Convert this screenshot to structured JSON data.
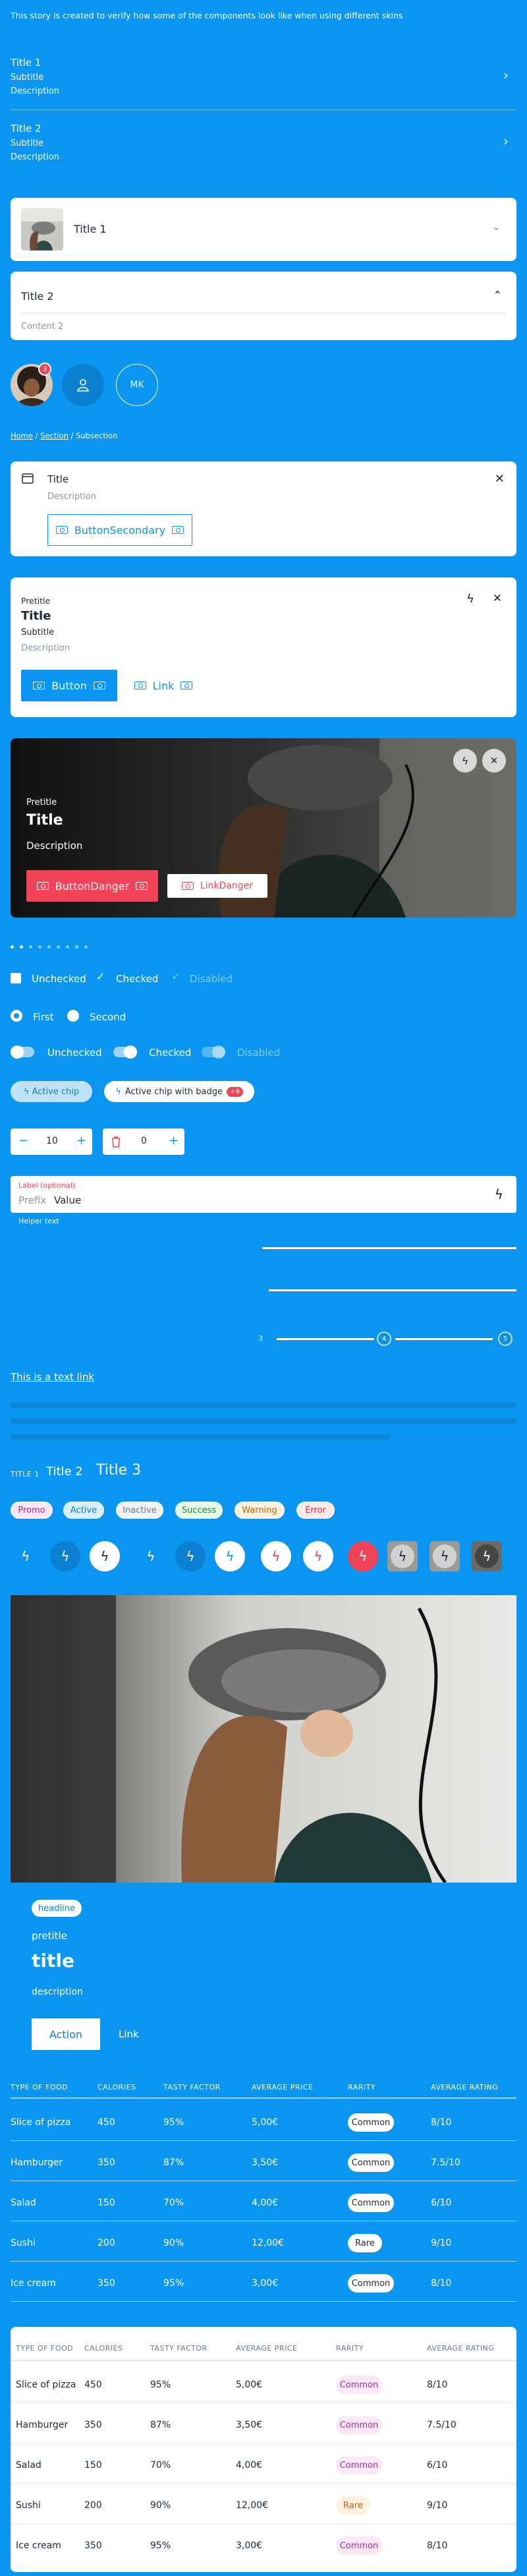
{
  "intro": "This story is created to verify how some of the components look like when using different skins",
  "list_items": [
    {
      "title": "Title 1",
      "subtitle": "Subtitle",
      "description": "Description"
    },
    {
      "title": "Title 2",
      "subtitle": "Subtitle",
      "description": "Description"
    }
  ],
  "accordion": {
    "item1_title": "Title 1",
    "item2_title": "Title 2",
    "item2_content": "Content 2"
  },
  "avatars": {
    "badge_count": "3",
    "initials": "MK"
  },
  "breadcrumb": {
    "home": "Home",
    "section": "Section",
    "current": "Subsection"
  },
  "callout": {
    "title": "Title",
    "description": "Description",
    "button_label": "ButtonSecondary"
  },
  "info_card": {
    "pretitle": "Pretitle",
    "title": "Title",
    "subtitle": "Subtitle",
    "description": "Description",
    "button_label": "Button",
    "link_label": "Link"
  },
  "media_card": {
    "pretitle": "Pretitle",
    "title": "Title",
    "description": "Description",
    "button_label": "ButtonDanger",
    "link_label": "LinkDanger"
  },
  "checkboxes": {
    "unchecked": "Unchecked",
    "checked": "Checked",
    "disabled": "Disabled"
  },
  "radios": {
    "first": "First",
    "second": "Second"
  },
  "switches": {
    "unchecked": "Unchecked",
    "checked": "Checked",
    "disabled": "Disabled"
  },
  "chips": {
    "active": "Active chip",
    "badge_chip": "Active chip with badge",
    "badge_count": "+9"
  },
  "stepper_a": {
    "value": "10"
  },
  "stepper_b": {
    "value": "0"
  },
  "textfield": {
    "label": "Label (optional)",
    "prefix": "Prefix",
    "value": "Value",
    "helper": "Helper text"
  },
  "slider": {
    "min_label": "3",
    "mid_label": "4",
    "max_label": "5"
  },
  "text_link": "This is a text link",
  "titles": {
    "t1": "TITLE 1",
    "t2": "Title 2",
    "t3": "Title 3"
  },
  "tags": [
    "Promo",
    "Active",
    "Inactive",
    "Success",
    "Warning",
    "Error"
  ],
  "hero": {
    "tag": "headline",
    "pretitle": "pretitle",
    "title": "title",
    "description": "description",
    "button_label": "Action",
    "link_label": "Link"
  },
  "table_headers": [
    "TYPE OF FOOD",
    "CALORIES",
    "TASTY FACTOR",
    "AVERAGE PRICE",
    "RARITY",
    "AVERAGE RATING"
  ],
  "table_rows": [
    [
      "Slice of pizza",
      "450",
      "95%",
      "5,00€",
      "Common",
      "8/10"
    ],
    [
      "Hamburger",
      "350",
      "87%",
      "3,50€",
      "Common",
      "7.5/10"
    ],
    [
      "Salad",
      "150",
      "70%",
      "4,00€",
      "Common",
      "6/10"
    ],
    [
      "Sushi",
      "200",
      "90%",
      "12,00€",
      "Rare",
      "9/10"
    ],
    [
      "Ice cream",
      "350",
      "95%",
      "3,00€",
      "Common",
      "8/10"
    ]
  ],
  "colors": {
    "brand": "#0a96f0",
    "danger": "#f24458",
    "dark": "#1d2a36"
  }
}
